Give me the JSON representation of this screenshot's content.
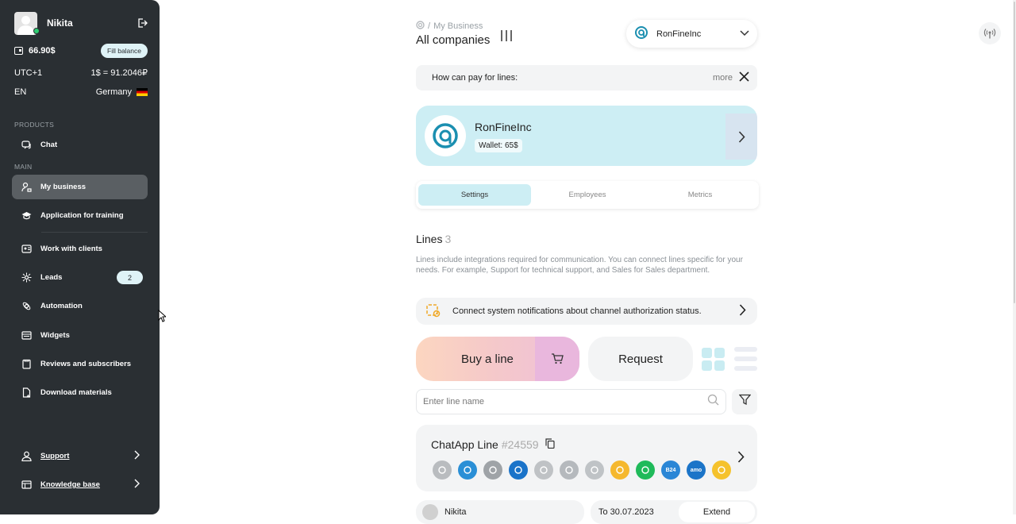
{
  "sidebar": {
    "user_name": "Nikita",
    "balance": "66.90$",
    "fill_balance_label": "Fill balance",
    "timezone": "UTC+1",
    "rate": "1$ = 91.2046₽",
    "language": "EN",
    "country": "Germany",
    "products_label": "PRODUCTS",
    "main_label": "MAIN",
    "items": [
      {
        "label": "Chat",
        "icon": "chat-icon"
      },
      {
        "label": "My business",
        "icon": "business-icon"
      },
      {
        "label": "Application for training",
        "icon": "graduation-cap-icon"
      },
      {
        "label": "Work with clients",
        "icon": "clients-icon"
      },
      {
        "label": "Leads",
        "icon": "leads-icon",
        "badge": "2"
      },
      {
        "label": "Automation",
        "icon": "automation-icon"
      },
      {
        "label": "Widgets",
        "icon": "widgets-icon"
      },
      {
        "label": "Reviews and subscribers",
        "icon": "reviews-icon"
      },
      {
        "label": "Download materials",
        "icon": "download-icon"
      }
    ],
    "support_label": "Support",
    "knowledge_label": "Knowledge base"
  },
  "header": {
    "breadcrumb": "My Business",
    "title": "All companies",
    "company_select": "RonFineInc"
  },
  "pay_banner": {
    "text": "How can pay for lines:",
    "more": "more"
  },
  "company_card": {
    "name": "RonFineInc",
    "wallet_label": "Wallet:",
    "wallet_value": "65$"
  },
  "tabs": [
    "Settings",
    "Employees",
    "Metrics"
  ],
  "lines": {
    "heading": "Lines",
    "count": "3",
    "description": "Lines include integrations required for communication. You can connect lines specific for your needs. For example, Support for technical support, and Sales for Sales department.",
    "notify_text": "Connect system notifications about channel authorization status.",
    "buy_label": "Buy a line",
    "request_label": "Request",
    "search_placeholder": "Enter line name"
  },
  "line_card": {
    "name": "ChatApp Line",
    "id": "#24559",
    "channels": [
      {
        "icon": "chatapp-icon",
        "color": "#b9bcbf"
      },
      {
        "icon": "telegram-icon",
        "color": "#2a8fd6"
      },
      {
        "icon": "viber-icon",
        "color": "#9fa3a7"
      },
      {
        "icon": "avito-icon",
        "color": "#1a73c9"
      },
      {
        "icon": "facebook-icon",
        "color": "#bfc2c5"
      },
      {
        "icon": "vk-icon",
        "color": "#b5b9bd"
      },
      {
        "icon": "whatsapp-icon",
        "color": "#bfc3c6"
      },
      {
        "icon": "email-icon",
        "color": "#f5b82e"
      },
      {
        "icon": "whatsapp-business-icon",
        "color": "#1fba5a"
      },
      {
        "icon": "bitrix24-icon",
        "color": "#2a86d6",
        "label": "B24"
      },
      {
        "icon": "amocrm-icon",
        "color": "#1b74c8",
        "label": "amo"
      },
      {
        "icon": "yandex-icon",
        "color": "#f5c22c"
      }
    ]
  },
  "bottom_row": {
    "user": "Nikita",
    "date": "To 30.07.2023",
    "extend_label": "Extend"
  }
}
